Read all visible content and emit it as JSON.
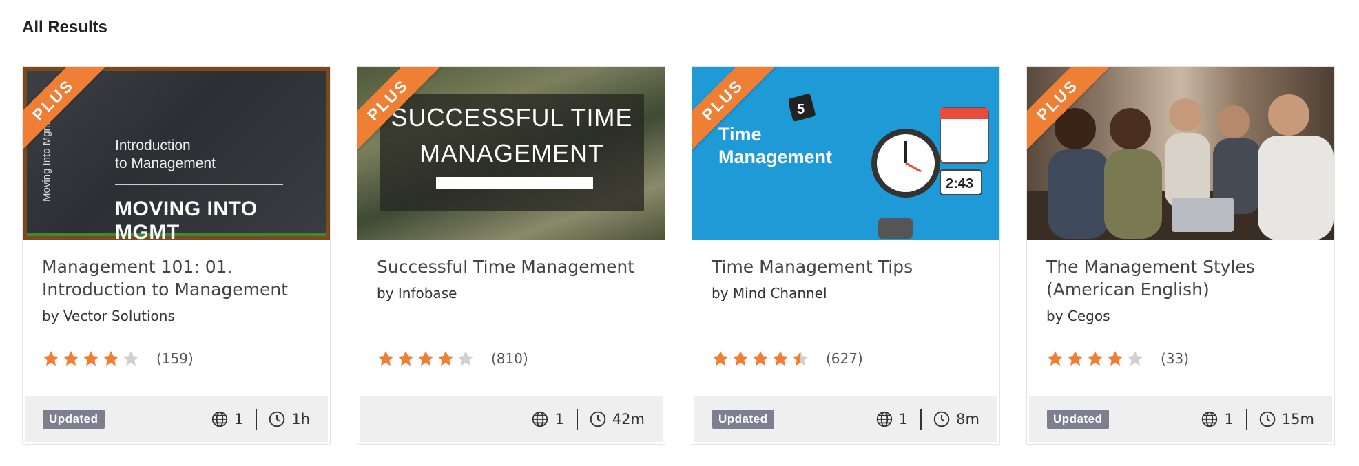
{
  "section": {
    "title": "All Results"
  },
  "ribbon_label": "PLUS",
  "colors": {
    "accent": "#f07f36",
    "star_filled": "#f07f36",
    "star_empty": "#d0d0d0",
    "badge": "#7d7f8f"
  },
  "cards": [
    {
      "title": "Management 101: 01. Introduction to Management",
      "author": "by Vector Solutions",
      "rating": 4.0,
      "rating_count": "(159)",
      "badge": "Updated",
      "languages": "1",
      "duration": "1h",
      "thumb": {
        "vertical": "Moving Into Mgmt",
        "line1": "Introduction",
        "line2": "to Management",
        "headline": "MOVING INTO MGMT"
      }
    },
    {
      "title": "Successful Time Management",
      "author": "by Infobase",
      "rating": 4.0,
      "rating_count": "(810)",
      "badge": "",
      "languages": "1",
      "duration": "42m",
      "thumb": {
        "line1": "SUCCESSFUL TIME",
        "line2": "MANAGEMENT"
      }
    },
    {
      "title": "Time Management Tips",
      "author": "by Mind Channel",
      "rating": 4.5,
      "rating_count": "(627)",
      "badge": "Updated",
      "languages": "1",
      "duration": "8m",
      "thumb": {
        "line1": "Time",
        "line2": "Management"
      }
    },
    {
      "title": "The Management Styles (American English)",
      "author": "by Cegos",
      "rating": 4.0,
      "rating_count": "(33)",
      "badge": "Updated",
      "languages": "1",
      "duration": "15m",
      "thumb": {}
    }
  ]
}
